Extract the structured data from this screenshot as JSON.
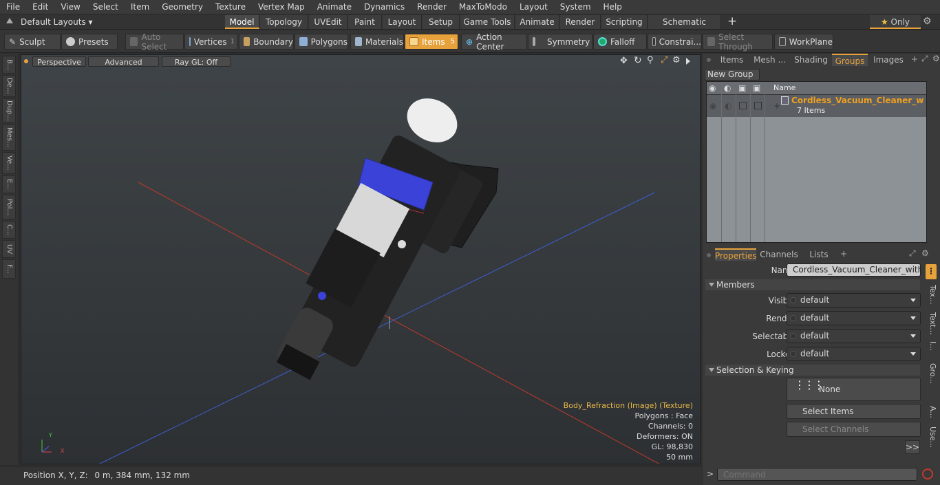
{
  "menubar": {
    "items": [
      "File",
      "Edit",
      "View",
      "Select",
      "Item",
      "Geometry",
      "Texture",
      "Vertex Map",
      "Animate",
      "Dynamics",
      "Render",
      "MaxToModo",
      "Layout",
      "System",
      "Help"
    ]
  },
  "tabbar": {
    "layouts_label": "Default Layouts",
    "tabs": [
      "Model",
      "Topology",
      "UVEdit",
      "Paint",
      "Layout",
      "Setup",
      "Game Tools",
      "Animate",
      "Render",
      "Scripting",
      "Schematic Fusion"
    ],
    "active_tab": "Model",
    "only_label": "Only"
  },
  "toolbar": {
    "sculpt": "Sculpt",
    "presets": "Presets",
    "auto_select": "Auto Select",
    "vertices": "Vertices",
    "vertices_count": "1",
    "boundary": "Boundary",
    "polygons": "Polygons",
    "materials": "Materials",
    "items": "Items",
    "items_count": "5",
    "action_center": "Action Center",
    "symmetry": "Symmetry",
    "falloff": "Falloff",
    "constraints": "Constrai...",
    "select_through": "Select Through",
    "workplane": "WorkPlane"
  },
  "lefttabs": [
    "B...",
    "De...",
    "Dup...",
    "Mes...",
    "Ve...",
    "E...",
    "Pol...",
    "C...",
    "UV",
    "F..."
  ],
  "viewport": {
    "perspective": "Perspective",
    "advanced": "Advanced",
    "raygl": "Ray GL: Off",
    "info": {
      "texture": "Body_Refraction (Image) (Texture)",
      "polygons": "Polygons : Face",
      "channels": "Channels: 0",
      "deformers": "Deformers: ON",
      "gl": "GL: 98,830",
      "scale": "50 mm"
    },
    "axis_x": "X",
    "axis_y": "Y",
    "axis_z": "Z"
  },
  "statusbar": {
    "label": "Position X, Y, Z:",
    "value": "0 m, 384 mm, 132 mm"
  },
  "rightpanel": {
    "tabs": [
      "Items",
      "Mesh ...",
      "Shading",
      "Groups",
      "Images"
    ],
    "active_tab": "Groups",
    "new_group": "New Group",
    "table": {
      "name_header": "Name",
      "group_name": "Cordless_Vacuum_Cleaner_with...",
      "group_count": "7 Items"
    },
    "prop_tabs": [
      "Properties",
      "Channels",
      "Lists"
    ],
    "name_label": "Name",
    "name_value": "Cordless_Vacuum_Cleaner_with_Brush",
    "members": "Members",
    "fields": [
      {
        "label": "Visible",
        "value": "default"
      },
      {
        "label": "Render",
        "value": "default"
      },
      {
        "label": "Selectable",
        "value": "default"
      },
      {
        "label": "Locked",
        "value": "default"
      }
    ],
    "selection_keying": "Selection & Keying",
    "none": "None",
    "select_items": "Select Items",
    "select_channels": "Select Channels",
    "more": ">>",
    "side_tabs": [
      "Tex...",
      "Text...",
      "I...",
      "Gro...",
      "A...",
      "Use..."
    ],
    "command_placeholder": "Command"
  },
  "colors": {
    "accent": "#e8a23c",
    "group_text": "#f0a020"
  }
}
